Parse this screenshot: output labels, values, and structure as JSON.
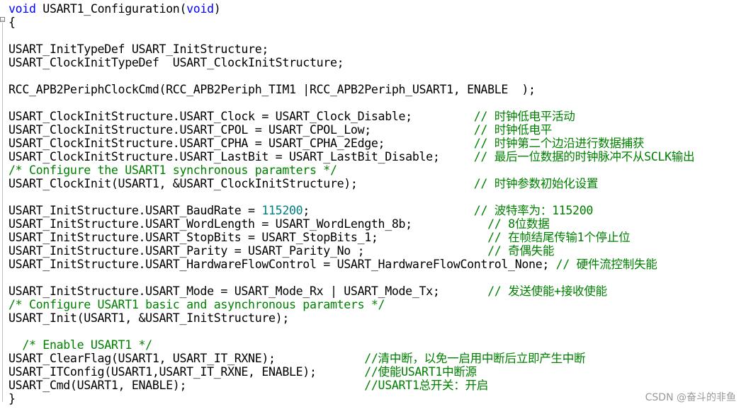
{
  "lines": [
    {
      "parts": [
        {
          "t": "void",
          "c": "kw"
        },
        {
          "t": " USART1_Configuration("
        },
        {
          "t": "void",
          "c": "kw"
        },
        {
          "t": ")"
        }
      ]
    },
    {
      "parts": [
        {
          "t": "{"
        }
      ]
    },
    {
      "parts": []
    },
    {
      "parts": [
        {
          "t": "USART_InitTypeDef USART_InitStructure;"
        }
      ]
    },
    {
      "parts": [
        {
          "t": "USART_ClockInitTypeDef  USART_ClockInitStructure;"
        }
      ]
    },
    {
      "parts": []
    },
    {
      "parts": [
        {
          "t": "RCC_APB2PeriphClockCmd(RCC_APB2Periph_TIM1 |RCC_APB2Periph_USART1, ENABLE  );"
        }
      ]
    },
    {
      "parts": []
    },
    {
      "parts": [
        {
          "t": "USART_ClockInitStructure.USART_Clock = USART_Clock_Disable;         "
        },
        {
          "t": "// 时钟低电平活动",
          "c": "cm"
        }
      ]
    },
    {
      "parts": [
        {
          "t": "USART_ClockInitStructure.USART_CPOL = USART_CPOL_Low;               "
        },
        {
          "t": "// 时钟低电平",
          "c": "cm"
        }
      ]
    },
    {
      "parts": [
        {
          "t": "USART_ClockInitStructure.USART_CPHA = USART_CPHA_2Edge;             "
        },
        {
          "t": "// 时钟第二个边沿进行数据捕获",
          "c": "cm"
        }
      ]
    },
    {
      "parts": [
        {
          "t": "USART_ClockInitStructure.USART_LastBit = USART_LastBit_Disable;     "
        },
        {
          "t": "// 最后一位数据的时钟脉冲不从SCLK输出",
          "c": "cm"
        }
      ]
    },
    {
      "parts": [
        {
          "t": "/* Configure the USART1 synchronous paramters */",
          "c": "cm"
        }
      ]
    },
    {
      "parts": [
        {
          "t": "USART_ClockInit(USART1, &USART_ClockInitStructure);                 "
        },
        {
          "t": "// 时钟参数初始化设置",
          "c": "cm"
        }
      ]
    },
    {
      "parts": []
    },
    {
      "parts": [
        {
          "t": "USART_InitStructure.USART_BaudRate = "
        },
        {
          "t": "115200",
          "c": "num"
        },
        {
          "t": ";                        "
        },
        {
          "t": "// 波特率为：115200",
          "c": "cm"
        }
      ]
    },
    {
      "parts": [
        {
          "t": "USART_InitStructure.USART_WordLength = USART_WordLength_8b;           "
        },
        {
          "t": "// 8位数据",
          "c": "cm"
        }
      ]
    },
    {
      "parts": [
        {
          "t": "USART_InitStructure.USART_StopBits = USART_StopBits_1;                "
        },
        {
          "t": "// 在帧结尾传输1个停止位",
          "c": "cm"
        }
      ]
    },
    {
      "parts": [
        {
          "t": "USART_InitStructure.USART_Parity = USART_Parity_No ;                  "
        },
        {
          "t": "// 奇偶失能",
          "c": "cm"
        }
      ]
    },
    {
      "parts": [
        {
          "t": "USART_InitStructure.USART_HardwareFlowControl = USART_HardwareFlowControl_None; "
        },
        {
          "t": "// 硬件流控制失能",
          "c": "cm"
        }
      ]
    },
    {
      "parts": []
    },
    {
      "parts": [
        {
          "t": "USART_InitStructure.USART_Mode = USART_Mode_Rx | USART_Mode_Tx;       "
        },
        {
          "t": "// 发送使能+接收使能",
          "c": "cm"
        }
      ]
    },
    {
      "parts": [
        {
          "t": "/* Configure USART1 basic and asynchronous paramters */",
          "c": "cm"
        }
      ]
    },
    {
      "parts": [
        {
          "t": "USART_Init(USART1, &USART_InitStructure);"
        }
      ]
    },
    {
      "parts": []
    },
    {
      "parts": [
        {
          "t": "  "
        },
        {
          "t": "/* Enable USART1 */",
          "c": "cm"
        }
      ]
    },
    {
      "parts": [
        {
          "t": "USART_ClearFlag(USART1, USART_IT_RXNE);             "
        },
        {
          "t": "//清中断，以免一启用中断后立即产生中断",
          "c": "cm"
        }
      ]
    },
    {
      "parts": [
        {
          "t": "USART_ITConfig(USART1,USART_IT_RXNE, ENABLE);       "
        },
        {
          "t": "//使能USART1中断源",
          "c": "cm"
        }
      ]
    },
    {
      "parts": [
        {
          "t": "USART_Cmd(USART1, ENABLE);                          "
        },
        {
          "t": "//USART1总开关：开启",
          "c": "cm"
        }
      ]
    },
    {
      "parts": [
        {
          "t": "}"
        }
      ]
    }
  ],
  "watermark": "CSDN @奋斗的非鱼"
}
